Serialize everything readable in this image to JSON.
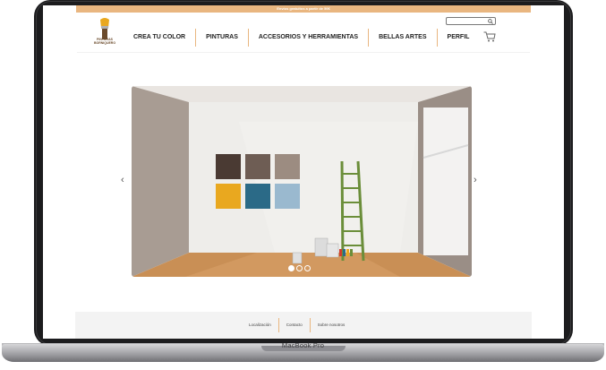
{
  "promo": {
    "text": "Envíos gratuitos a partir de  50€"
  },
  "brand": {
    "logo_text_line1": "PINTURAS",
    "logo_text_line2": "BORNIQUERO"
  },
  "nav": {
    "items": [
      {
        "label": "CREA TU COLOR"
      },
      {
        "label": "PINTURAS"
      },
      {
        "label": "ACCESORIOS Y HERRAMIENTAS"
      },
      {
        "label": "BELLAS ARTES"
      },
      {
        "label": "PERFIL"
      }
    ]
  },
  "search": {
    "placeholder": "",
    "icon": "search-icon"
  },
  "cart": {
    "icon": "cart-icon"
  },
  "hero": {
    "arrow_left": "‹",
    "arrow_right": "›",
    "slides_total": 3,
    "active_slide": 1,
    "swatches": [
      "#4a3a33",
      "#6e5d54",
      "#9c8c81",
      "#e9a81f",
      "#2b6a87",
      "#9ab9cf"
    ]
  },
  "footer": {
    "links": [
      {
        "label": "Localización"
      },
      {
        "label": "Contacto"
      },
      {
        "label": "Sobre nosotros"
      }
    ]
  },
  "device": {
    "model": "MacBook Pro"
  },
  "colors": {
    "accent": "#e9b680",
    "frame": "#1c1c1e"
  }
}
